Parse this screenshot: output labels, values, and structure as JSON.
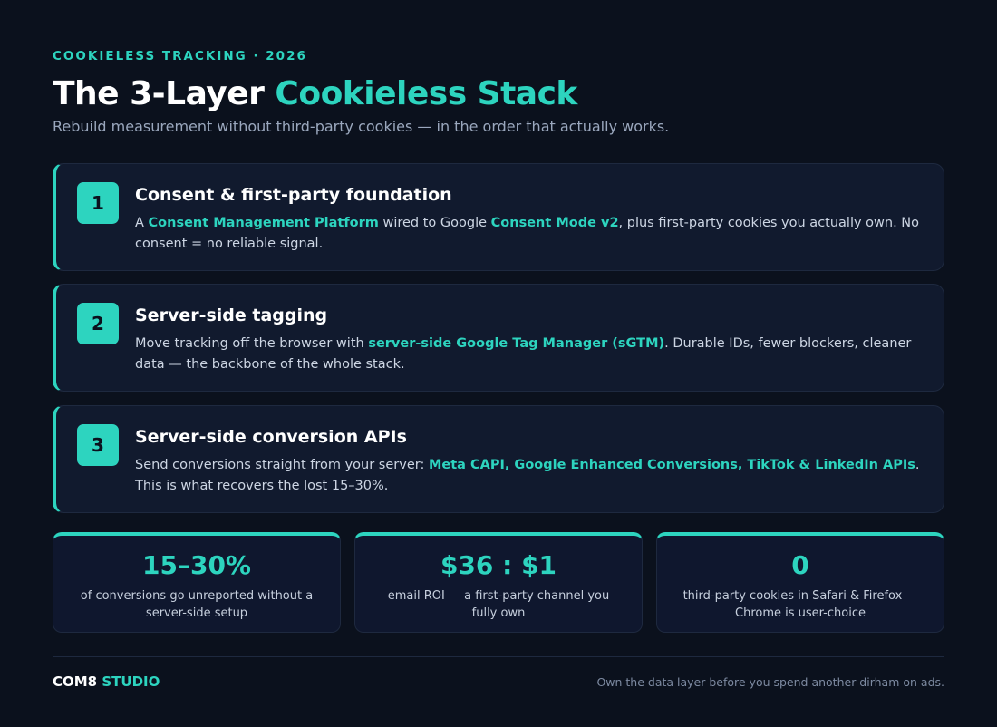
{
  "header": {
    "eyebrow": "COOKIELESS TRACKING · 2026",
    "title_lead": "The 3-Layer ",
    "title_accent": "Cookieless Stack",
    "subtitle": "Rebuild measurement without third-party cookies — in the order that actually works."
  },
  "layers": [
    {
      "number": "1",
      "title": "Consent & first-party foundation",
      "desc": [
        {
          "text": "A ",
          "hl": false
        },
        {
          "text": "Consent Management Platform",
          "hl": true
        },
        {
          "text": " wired to Google ",
          "hl": false
        },
        {
          "text": "Consent Mode v2",
          "hl": true
        },
        {
          "text": ", plus first-party cookies you actually own. No consent = no reliable signal.",
          "hl": false
        }
      ]
    },
    {
      "number": "2",
      "title": "Server-side tagging",
      "desc": [
        {
          "text": "Move tracking off the browser with ",
          "hl": false
        },
        {
          "text": "server-side Google Tag Manager (sGTM)",
          "hl": true
        },
        {
          "text": ". Durable IDs, fewer blockers, cleaner data — the backbone of the whole stack.",
          "hl": false
        }
      ]
    },
    {
      "number": "3",
      "title": "Server-side conversion APIs",
      "desc": [
        {
          "text": "Send conversions straight from your server: ",
          "hl": false
        },
        {
          "text": "Meta CAPI, Google Enhanced Conversions, TikTok & LinkedIn APIs",
          "hl": true
        },
        {
          "text": ". This is what recovers the lost 15–30%.",
          "hl": false
        }
      ]
    }
  ],
  "stats": [
    {
      "value": "15–30%",
      "label": "of conversions go unreported without a server-side setup"
    },
    {
      "value": "$36 : $1",
      "label": "email ROI — a first-party channel you fully own"
    },
    {
      "value": "0",
      "label": "third-party cookies in Safari & Firefox — Chrome is user-choice"
    }
  ],
  "footer": {
    "brand_a": "COM8",
    "brand_b": "STUDIO",
    "tagline": "Own the data layer before you spend another dirham on ads."
  },
  "colors": {
    "accent": "#2dd4bf",
    "background": "#0b111d",
    "card": "#111a2e"
  }
}
